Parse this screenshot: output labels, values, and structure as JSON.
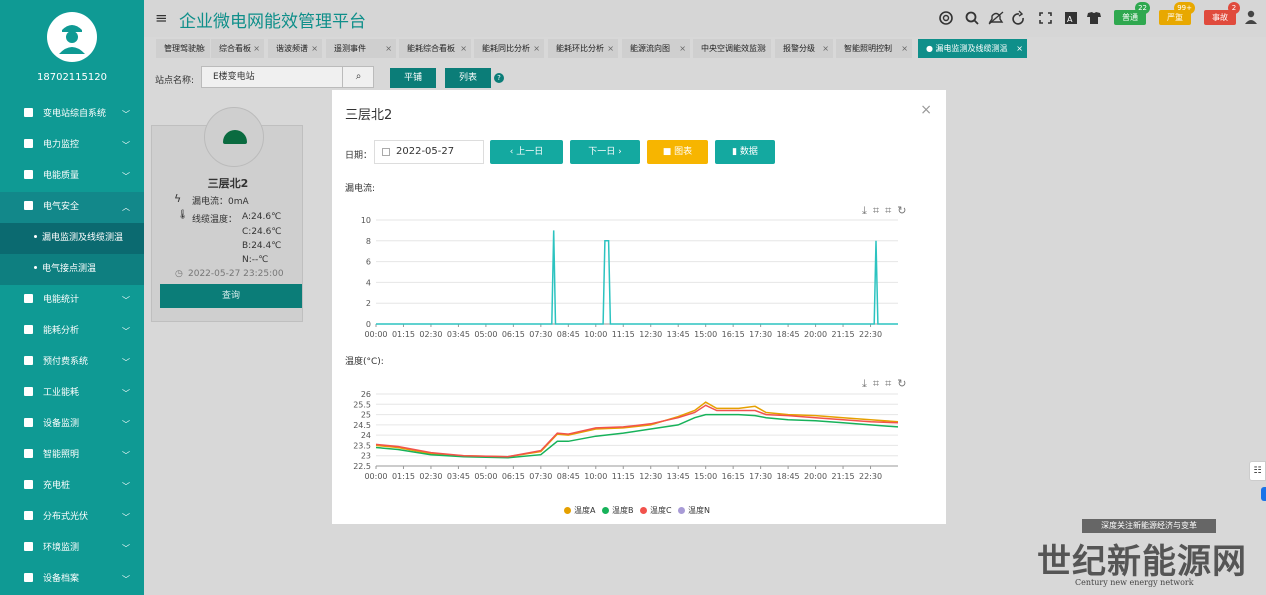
{
  "app": {
    "title": "企业微电网能效管理平台",
    "user_phone": "18702115120"
  },
  "colors": {
    "sidebar": "#0f9a94",
    "primary": "#14a9a0",
    "accent_orange": "#f7b500",
    "line_leak": "#2cc3c0",
    "tempA": "#e5a000",
    "tempB": "#17b25a",
    "tempC": "#f2524c",
    "tempN": "#a89bd6"
  },
  "sidebar": {
    "items": [
      {
        "label": "变电站综自系统",
        "icon": "home-icon"
      },
      {
        "label": "电力监控",
        "icon": "globe-icon"
      },
      {
        "label": "电能质量",
        "icon": "quality-icon"
      },
      {
        "label": "电气安全",
        "icon": "safety-icon"
      },
      {
        "label": "电能统计",
        "icon": "bar-chart-icon"
      },
      {
        "label": "能耗分析",
        "icon": "pie-chart-icon"
      },
      {
        "label": "预付费系统",
        "icon": "prepay-icon"
      },
      {
        "label": "工业能耗",
        "icon": "factory-icon"
      },
      {
        "label": "设备监测",
        "icon": "monitor-icon"
      },
      {
        "label": "智能照明",
        "icon": "bulb-icon"
      },
      {
        "label": "充电桩",
        "icon": "charger-icon"
      },
      {
        "label": "分布式光伏",
        "icon": "solar-icon"
      },
      {
        "label": "环境监测",
        "icon": "env-icon"
      },
      {
        "label": "设备档案",
        "icon": "archive-icon"
      }
    ],
    "subitems": [
      {
        "label": "漏电监测及线缆测温",
        "active": true
      },
      {
        "label": "电气接点测温",
        "active": false
      }
    ]
  },
  "header": {
    "badges": [
      {
        "label": "普通",
        "count": "22",
        "color": "#2fa84f",
        "count_color": "#2fa84f"
      },
      {
        "label": "严重",
        "count": "99+",
        "color": "#e8a800",
        "count_color": "#e8a800"
      },
      {
        "label": "事故",
        "count": "2",
        "color": "#e04a3c",
        "count_color": "#e04a3c"
      }
    ]
  },
  "tabs": [
    {
      "label": "管理驾驶舱"
    },
    {
      "label": "综合看板"
    },
    {
      "label": "谐波频谱"
    },
    {
      "label": "遥测事件"
    },
    {
      "label": "能耗综合看板"
    },
    {
      "label": "能耗同比分析"
    },
    {
      "label": "能耗环比分析"
    },
    {
      "label": "能源流向图"
    },
    {
      "label": "中央空调能效监测"
    },
    {
      "label": "报警分级"
    },
    {
      "label": "智能照明控制"
    },
    {
      "label": "漏电监测及线缆测温",
      "active": true
    }
  ],
  "filter": {
    "label": "站点名称:",
    "value": "E楼变电站",
    "btn_flat": "平铺",
    "btn_list": "列表"
  },
  "card": {
    "name": "三层北2",
    "leak_label": "漏电流：0mA",
    "temp_label": "线缆温度：",
    "temp_a": "A:24.6℃",
    "temp_c": "C:24.6℃",
    "temp_b": "B:24.4℃",
    "temp_n": "N:--℃",
    "time": "2022-05-27 23:25:00",
    "button": "查询"
  },
  "modal": {
    "title": "三层北2",
    "date_label": "日期：",
    "date_value": "2022-05-27",
    "prev": "上一日",
    "next": "下一日",
    "chart_btn": "图表",
    "data_btn": "数据"
  },
  "chart_data": [
    {
      "type": "line",
      "title": "漏电流:",
      "ylim": [
        0,
        10
      ],
      "yticks": [
        0,
        2,
        4,
        6,
        8,
        10
      ],
      "xticks": [
        "00:00",
        "01:15",
        "02:30",
        "03:45",
        "05:00",
        "06:15",
        "07:30",
        "08:45",
        "10:00",
        "11:15",
        "12:30",
        "13:45",
        "15:00",
        "16:15",
        "17:30",
        "18:45",
        "20:00",
        "21:15",
        "22:30"
      ],
      "x_range": [
        "00:00",
        "23:45"
      ],
      "grid": true,
      "series": [
        {
          "color": "#2cc3c0",
          "points": [
            [
              "00:00",
              0
            ],
            [
              "08:00",
              0
            ],
            [
              "08:05",
              9
            ],
            [
              "08:10",
              0
            ],
            [
              "10:20",
              0
            ],
            [
              "10:25",
              8
            ],
            [
              "10:35",
              8
            ],
            [
              "10:40",
              0
            ],
            [
              "22:40",
              0
            ],
            [
              "22:45",
              8
            ],
            [
              "22:50",
              0
            ],
            [
              "23:45",
              0
            ]
          ]
        }
      ]
    },
    {
      "type": "line",
      "title": "温度(°C):",
      "ylim": [
        22.5,
        26
      ],
      "yticks": [
        22.5,
        23,
        23.5,
        24,
        24.5,
        25,
        25.5,
        26
      ],
      "xticks": [
        "00:00",
        "01:15",
        "02:30",
        "03:45",
        "05:00",
        "06:15",
        "07:30",
        "08:45",
        "10:00",
        "11:15",
        "12:30",
        "13:45",
        "15:00",
        "16:15",
        "17:30",
        "18:45",
        "20:00",
        "21:15",
        "22:30"
      ],
      "x_range": [
        "00:00",
        "23:45"
      ],
      "grid": true,
      "legend": "bottom",
      "series": [
        {
          "name": "温度A",
          "color": "#e5a000",
          "points": [
            [
              "00:00",
              23.5
            ],
            [
              "01:00",
              23.4
            ],
            [
              "02:30",
              23.1
            ],
            [
              "04:00",
              23.0
            ],
            [
              "06:00",
              22.95
            ],
            [
              "07:30",
              23.2
            ],
            [
              "08:15",
              24.05
            ],
            [
              "08:45",
              24.0
            ],
            [
              "10:00",
              24.3
            ],
            [
              "11:15",
              24.35
            ],
            [
              "12:30",
              24.5
            ],
            [
              "13:45",
              24.9
            ],
            [
              "14:30",
              25.2
            ],
            [
              "15:00",
              25.6
            ],
            [
              "15:30",
              25.3
            ],
            [
              "16:30",
              25.3
            ],
            [
              "17:15",
              25.4
            ],
            [
              "17:45",
              25.1
            ],
            [
              "18:45",
              25.0
            ],
            [
              "20:00",
              24.95
            ],
            [
              "21:15",
              24.85
            ],
            [
              "22:30",
              24.75
            ],
            [
              "23:45",
              24.65
            ]
          ]
        },
        {
          "name": "温度B",
          "color": "#17b25a",
          "points": [
            [
              "00:00",
              23.4
            ],
            [
              "01:00",
              23.3
            ],
            [
              "02:30",
              23.05
            ],
            [
              "04:00",
              22.95
            ],
            [
              "06:00",
              22.9
            ],
            [
              "07:30",
              23.05
            ],
            [
              "08:15",
              23.7
            ],
            [
              "08:45",
              23.7
            ],
            [
              "10:00",
              23.95
            ],
            [
              "11:15",
              24.1
            ],
            [
              "12:30",
              24.3
            ],
            [
              "13:45",
              24.5
            ],
            [
              "14:30",
              24.85
            ],
            [
              "15:00",
              25.0
            ],
            [
              "15:30",
              25.0
            ],
            [
              "16:30",
              25.0
            ],
            [
              "17:15",
              24.95
            ],
            [
              "17:45",
              24.85
            ],
            [
              "18:45",
              24.75
            ],
            [
              "20:00",
              24.7
            ],
            [
              "21:15",
              24.6
            ],
            [
              "22:30",
              24.5
            ],
            [
              "23:45",
              24.4
            ]
          ]
        },
        {
          "name": "温度C",
          "color": "#f2524c",
          "points": [
            [
              "00:00",
              23.55
            ],
            [
              "01:00",
              23.45
            ],
            [
              "02:30",
              23.15
            ],
            [
              "04:00",
              23.0
            ],
            [
              "06:00",
              22.95
            ],
            [
              "07:30",
              23.25
            ],
            [
              "08:15",
              24.1
            ],
            [
              "08:45",
              24.05
            ],
            [
              "10:00",
              24.35
            ],
            [
              "11:15",
              24.4
            ],
            [
              "12:30",
              24.55
            ],
            [
              "13:45",
              24.85
            ],
            [
              "14:30",
              25.1
            ],
            [
              "15:00",
              25.45
            ],
            [
              "15:30",
              25.2
            ],
            [
              "16:30",
              25.2
            ],
            [
              "17:15",
              25.2
            ],
            [
              "17:45",
              25.0
            ],
            [
              "18:45",
              24.95
            ],
            [
              "20:00",
              24.85
            ],
            [
              "21:15",
              24.75
            ],
            [
              "22:30",
              24.65
            ],
            [
              "23:45",
              24.6
            ]
          ]
        },
        {
          "name": "温度N",
          "color": "#a89bd6",
          "points": []
        }
      ]
    }
  ]
}
